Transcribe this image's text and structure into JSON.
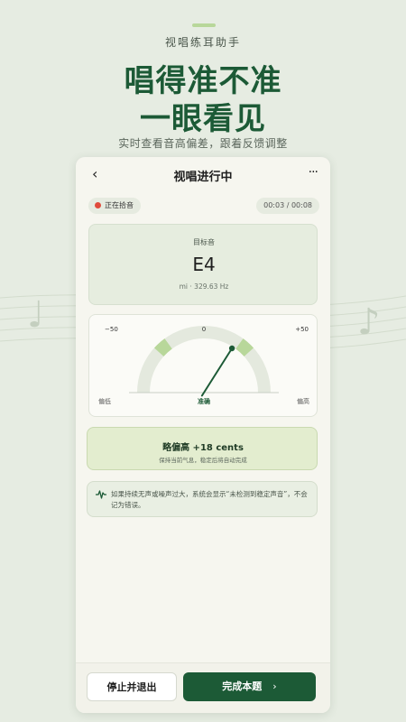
{
  "promo": {
    "kicker": "视唱练耳助手",
    "headline_line1": "唱得准不准",
    "headline_line2": "一眼看见",
    "subtitle": "实时查看音高偏差，跟着反馈调整"
  },
  "topbar": {
    "title": "视唱进行中",
    "back_icon": "‹",
    "more_icon": "···"
  },
  "status_pills": {
    "recording_label": "正在拾音",
    "time": "00:03 / 00:08"
  },
  "target": {
    "label": "目标音",
    "note": "E4",
    "freq": "mi · 329.63 Hz"
  },
  "gauge": {
    "min_label": "−50",
    "center_label": "0",
    "max_label": "+50",
    "low_label": "偏低",
    "center_caption": "准确",
    "high_label": "偏高",
    "deviation_cents": 18,
    "range_cents": 50
  },
  "feedback": {
    "main": "略偏高 +18 cents",
    "sub": "保持当前气息，稳定后将自动完成"
  },
  "info": {
    "icon": "waveform-icon",
    "text": "如果持续无声或噪声过大，系统会显示“未检测到稳定声音”，不会记为错误。"
  },
  "actions": {
    "stop_label": "停止并退出",
    "done_label": "完成本题",
    "done_chevron": "›"
  },
  "colors": {
    "brand": "#1c5a36",
    "accent": "#b8d79a",
    "record": "#e04b3c"
  }
}
